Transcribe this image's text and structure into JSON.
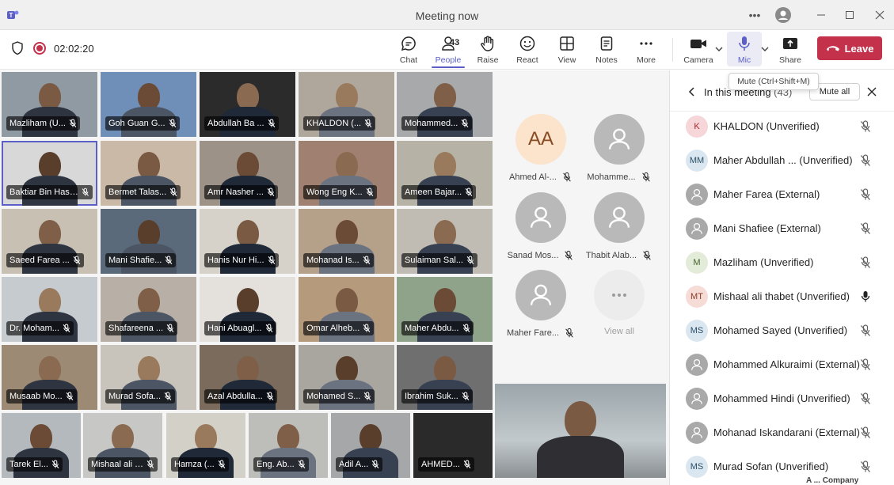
{
  "window": {
    "title": "Meeting now"
  },
  "toolbar": {
    "timer": "02:02:20",
    "chat": "Chat",
    "people": "People",
    "people_count": "43",
    "raise": "Raise",
    "react": "React",
    "view": "View",
    "notes": "Notes",
    "more": "More",
    "camera": "Camera",
    "mic": "Mic",
    "share": "Share",
    "leave": "Leave",
    "mic_tooltip": "Mute (Ctrl+Shift+M)",
    "accent": "#5b5fc7",
    "leave_color": "#c4314b"
  },
  "tiles": [
    "Mazliham (U...",
    "Goh Guan G...",
    "Abdullah Ba ...",
    "KHALDON (...",
    "Mohammed...",
    "Baktiar Bin Hasn...",
    "Bermet Talas...",
    "Amr Nasher ...",
    "Wong Eng K...",
    "Ameen Bajar...",
    "Saeed Farea ...",
    "Mani Shafie...",
    "Hanis Nur Hi...",
    "Mohanad Is...",
    "Sulaiman Sal...",
    "Dr. Moham...",
    "Shafareena ...",
    "Hani Abuagl...",
    "Omar Alheb...",
    "Maher Abdu...",
    "Musaab Mo...",
    "Murad Sofa...",
    "Azal Abdulla...",
    "Mohamed S...",
    "Ibrahim Suk...",
    "Tarek El...",
    "Mishaal ali t...",
    "Hamza (...",
    "Eng. Ab...",
    "Adil A...",
    "AHMED..."
  ],
  "avatar_tiles": [
    {
      "initials": "AA",
      "name": "Ahmed Al-..."
    },
    {
      "initials": "",
      "name": "Mohamme..."
    },
    {
      "initials": "",
      "name": "Sanad Mos..."
    },
    {
      "initials": "",
      "name": "Thabit Alab..."
    },
    {
      "initials": "",
      "name": "Maher Fare..."
    },
    {
      "initials": "",
      "name": "View all"
    }
  ],
  "panel": {
    "title": "In this meeting",
    "count": "(43)",
    "mute_all": "Mute all",
    "participants": [
      {
        "initials": "K",
        "name": "KHALDON (Unverified)",
        "muted": true
      },
      {
        "initials": "MM",
        "name": "Maher Abdullah ...  (Unverified)",
        "muted": true
      },
      {
        "initials": "",
        "name": "Maher Farea (External)",
        "muted": true
      },
      {
        "initials": "",
        "name": "Mani Shafiee (External)",
        "muted": true
      },
      {
        "initials": "M",
        "name": "Mazliham (Unverified)",
        "muted": true
      },
      {
        "initials": "MT",
        "name": "Mishaal ali thabet (Unverified)",
        "muted": false
      },
      {
        "initials": "MS",
        "name": "Mohamed Sayed (Unverified)",
        "muted": true
      },
      {
        "initials": "",
        "name": "Mohammed Alkuraimi (External)",
        "muted": true
      },
      {
        "initials": "",
        "name": "Mohammed Hindi (Unverified)",
        "muted": true
      },
      {
        "initials": "",
        "name": "Mohanad Iskandarani (External)",
        "muted": true
      },
      {
        "initials": "MS",
        "name": "Murad Sofan (Unverified)",
        "muted": true
      }
    ]
  },
  "footer": {
    "brand": "A ... Company"
  }
}
